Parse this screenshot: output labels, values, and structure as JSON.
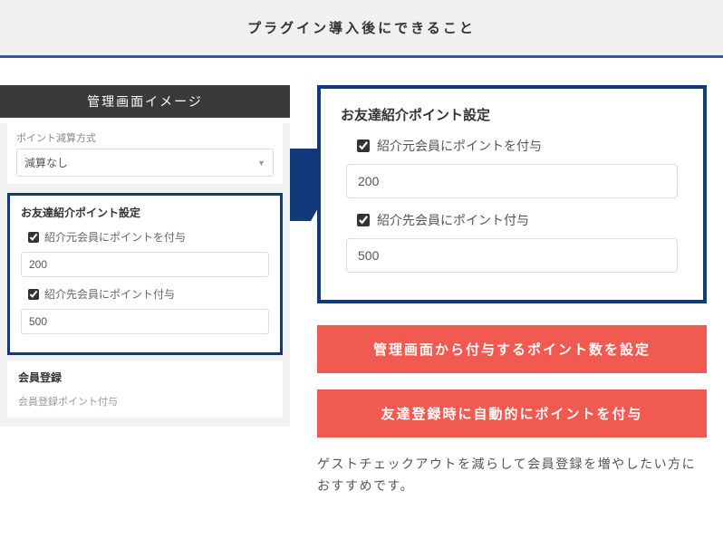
{
  "header": {
    "title": "プラグイン導入後にできること"
  },
  "left": {
    "panel_title": "管理画面イメージ",
    "point_calc": {
      "label": "ポイント減算方式",
      "value": "減算なし"
    },
    "referral": {
      "title": "お友達紹介ポイント設定",
      "check1_label": "紹介元会員にポイントを付与",
      "value1": "200",
      "check2_label": "紹介先会員にポイント付与",
      "value2": "500"
    },
    "member_reg": {
      "title": "会員登録",
      "line1": "会員登録ポイント付与"
    }
  },
  "right": {
    "referral": {
      "title": "お友達紹介ポイント設定",
      "check1_label": "紹介元会員にポイントを付与",
      "value1": "200",
      "check2_label": "紹介先会員にポイント付与",
      "value2": "500"
    },
    "callout1": "管理画面から付与するポイント数を設定",
    "callout2": "友達登録時に自動的にポイントを付与",
    "body": "ゲストチェックアウトを減らして会員登録を増やしたい方におすすめです。"
  }
}
